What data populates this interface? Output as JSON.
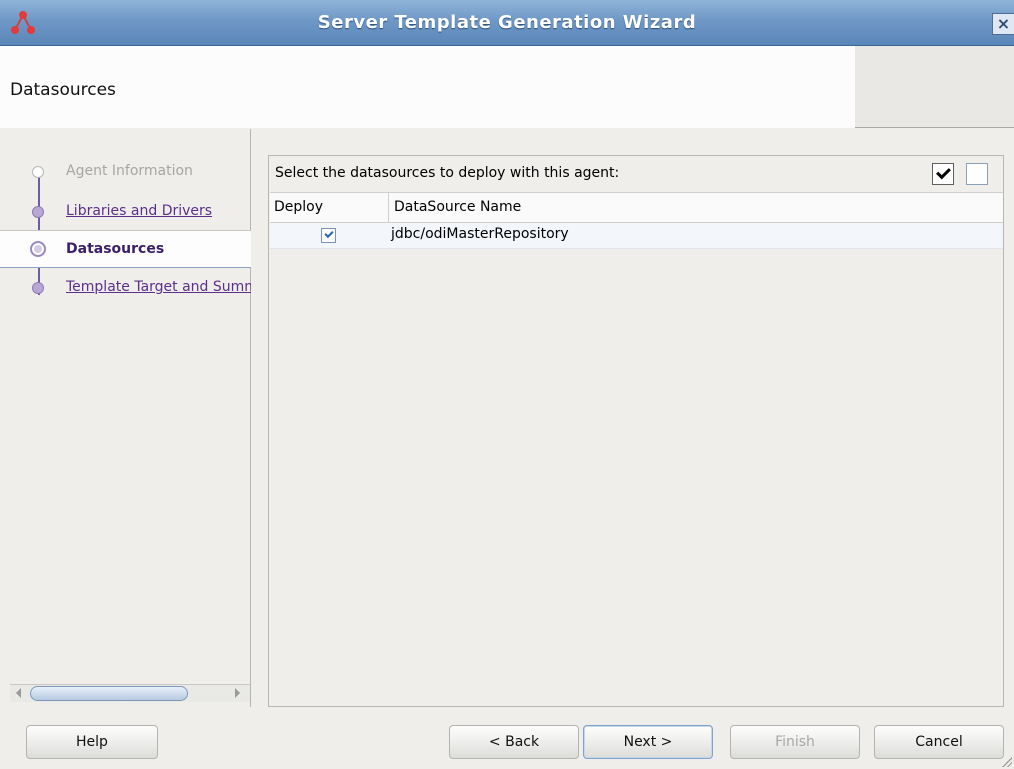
{
  "window": {
    "title": "Server Template Generation Wizard",
    "close_label": "×"
  },
  "header": {
    "page_title": "Datasources"
  },
  "nav": {
    "items": [
      {
        "label": "Agent Information",
        "state": "disabled"
      },
      {
        "label": "Libraries and Drivers",
        "state": "link"
      },
      {
        "label": "Datasources",
        "state": "current"
      },
      {
        "label": "Template Target and Summary",
        "state": "link"
      }
    ]
  },
  "content": {
    "prompt": "Select the datasources to deploy with this agent:",
    "table": {
      "columns": [
        "Deploy",
        "DataSource Name"
      ],
      "rows": [
        {
          "deploy": true,
          "name": "jdbc/odiMasterRepository"
        }
      ]
    }
  },
  "buttons": {
    "help": "Help",
    "back": "< Back",
    "next": "Next >",
    "finish": "Finish",
    "cancel": "Cancel"
  },
  "colors": {
    "titlebar": "#6f98c6",
    "nav_link": "#5b2f8a",
    "current_step": "#3a1e6a"
  }
}
